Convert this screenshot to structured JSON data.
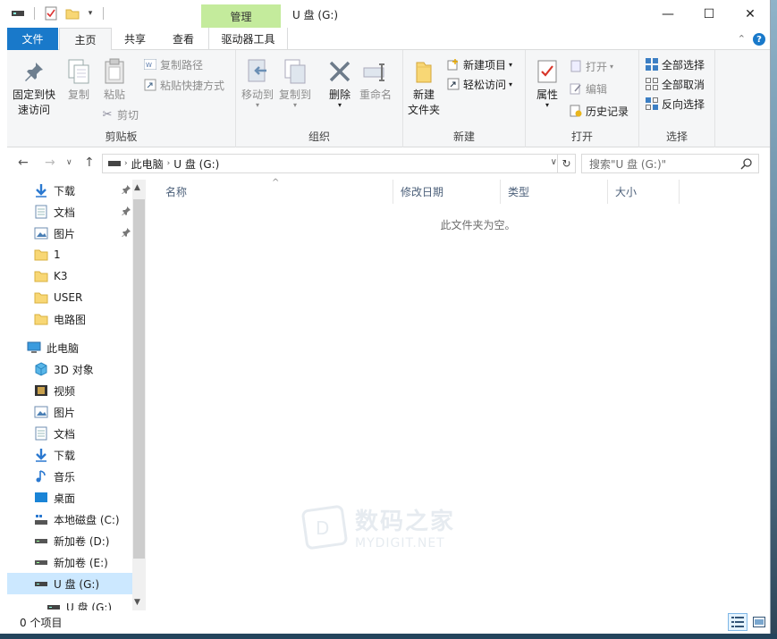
{
  "window": {
    "title": "U 盘 (G:)",
    "context_tab_group": "管理",
    "controls": {
      "minimize": "—",
      "maximize": "☐",
      "close": "✕"
    }
  },
  "ribbon_tabs": {
    "file": "文件",
    "home": "主页",
    "share": "共享",
    "view": "查看",
    "drive_tools": "驱动器工具"
  },
  "ribbon": {
    "clipboard": {
      "label": "剪贴板",
      "pin_line1": "固定到快",
      "pin_line2": "速访问",
      "copy": "复制",
      "paste": "粘贴",
      "copy_path": "复制路径",
      "paste_shortcut": "粘贴快捷方式",
      "cut": "剪切"
    },
    "organize": {
      "label": "组织",
      "move_to": "移动到",
      "copy_to": "复制到",
      "delete": "删除",
      "rename": "重命名"
    },
    "new": {
      "label": "新建",
      "new_folder_line1": "新建",
      "new_folder_line2": "文件夹",
      "new_item": "新建项目",
      "easy_access": "轻松访问"
    },
    "open": {
      "label": "打开",
      "properties": "属性",
      "open": "打开",
      "edit": "编辑",
      "history": "历史记录"
    },
    "select": {
      "label": "选择",
      "select_all": "全部选择",
      "select_none": "全部取消",
      "invert": "反向选择"
    }
  },
  "address": {
    "segment1": "此电脑",
    "segment2": "U 盘 (G:)",
    "search_placeholder": "搜索\"U 盘 (G:)\""
  },
  "nav_pane": {
    "items": [
      {
        "label": "下载",
        "icon": "download-icon",
        "pinned": true
      },
      {
        "label": "文档",
        "icon": "document-icon",
        "pinned": true
      },
      {
        "label": "图片",
        "icon": "picture-icon",
        "pinned": true
      },
      {
        "label": "1",
        "icon": "folder-icon"
      },
      {
        "label": "K3",
        "icon": "folder-icon"
      },
      {
        "label": "USER",
        "icon": "folder-icon"
      },
      {
        "label": "电路图",
        "icon": "folder-icon"
      },
      {
        "label": "此电脑",
        "icon": "computer-icon"
      },
      {
        "label": "3D 对象",
        "icon": "3d-objects-icon"
      },
      {
        "label": "视频",
        "icon": "video-icon"
      },
      {
        "label": "图片",
        "icon": "picture-icon"
      },
      {
        "label": "文档",
        "icon": "document-icon"
      },
      {
        "label": "下载",
        "icon": "download-icon"
      },
      {
        "label": "音乐",
        "icon": "music-icon"
      },
      {
        "label": "桌面",
        "icon": "desktop-icon"
      },
      {
        "label": "本地磁盘 (C:)",
        "icon": "system-drive-icon"
      },
      {
        "label": "新加卷 (D:)",
        "icon": "drive-icon"
      },
      {
        "label": "新加卷 (E:)",
        "icon": "drive-icon"
      },
      {
        "label": "U 盘 (G:)",
        "icon": "usb-drive-icon",
        "selected": true
      },
      {
        "label": "U 盘 (G:)",
        "icon": "usb-drive-icon"
      }
    ]
  },
  "columns": {
    "name": "名称",
    "modified": "修改日期",
    "type": "类型",
    "size": "大小"
  },
  "content": {
    "empty_message": "此文件夹为空。"
  },
  "status": {
    "item_count": "0 个项目"
  },
  "watermark": {
    "line1": "数码之家",
    "line2": "MYDIGIT.NET"
  },
  "colors": {
    "accent": "#1979ca",
    "context_tab": "#c4eb9c",
    "selection": "#cce8ff"
  }
}
